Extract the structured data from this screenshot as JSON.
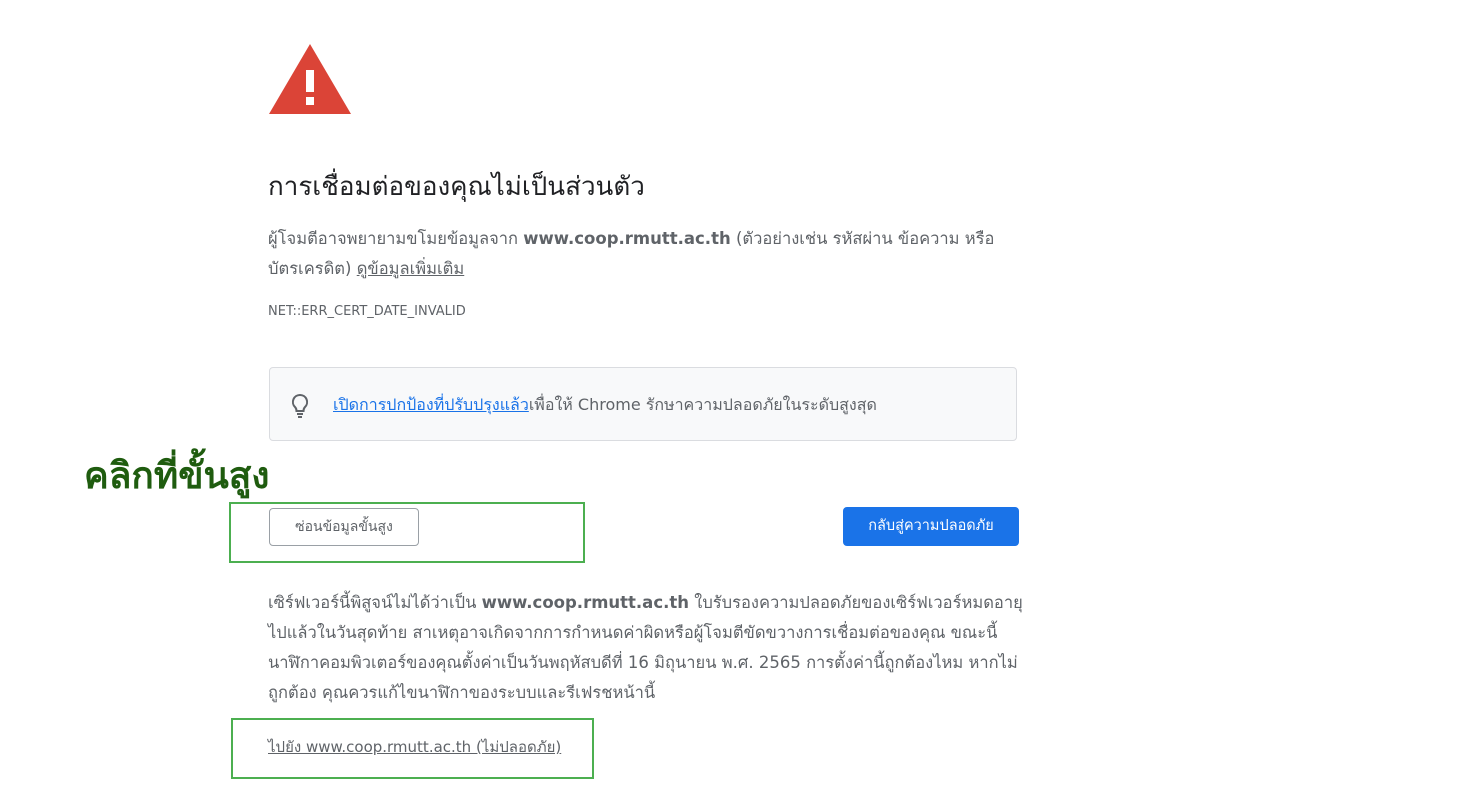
{
  "page": {
    "title": "การเชื่อมต่อของคุณไม่เป็นส่วนตัว",
    "explanation_prefix": "ผู้โจมตีอาจพยายามขโมยข้อมูลจาก ",
    "domain": "www.coop.rmutt.ac.th",
    "explanation_suffix": " (ตัวอย่างเช่น รหัสผ่าน ข้อความ หรือบัตรเครดิต) ",
    "learn_more": "ดูข้อมูลเพิ่มเติม",
    "error_code": "NET::ERR_CERT_DATE_INVALID"
  },
  "promo": {
    "icon": "lightbulb-icon",
    "link": "เปิดการปกป้องที่ปรับปรุงแล้ว",
    "text": "เพื่อให้ Chrome รักษาความปลอดภัยในระดับสูงสุด"
  },
  "annotation": {
    "text": "คลิกที่ขั้นสูง",
    "color": "#1f5c0f",
    "box_color": "#4caf50"
  },
  "buttons": {
    "hide_advanced": "ซ่อนข้อมูลขั้นสูง",
    "back_to_safety": "กลับสู่ความปลอดภัย"
  },
  "details": {
    "prefix": "เซิร์ฟเวอร์นี้พิสูจน์ไม่ได้ว่าเป็น ",
    "domain": "www.coop.rmutt.ac.th",
    "suffix": " ใบรับรองความปลอดภัยของเซิร์ฟเวอร์หมดอายุไปแล้วในวันสุดท้าย สาเหตุอาจเกิดจากการกำหนดค่าผิดหรือผู้โจมตีขัดขวางการเชื่อมต่อของคุณ ขณะนี้นาฬิกาคอมพิวเตอร์ของคุณตั้งค่าเป็นวันพฤหัสบดีที่ 16 มิถุนายน พ.ศ. 2565 การตั้งค่านี้ถูกต้องไหม หากไม่ถูกต้อง คุณควรแก้ไขนาฬิกาของระบบและรีเฟรชหน้านี้"
  },
  "proceed_link": "ไปยัง www.coop.rmutt.ac.th (ไม่ปลอดภัย)",
  "colors": {
    "warning_red": "#db4437",
    "primary_blue": "#1a73e8"
  }
}
